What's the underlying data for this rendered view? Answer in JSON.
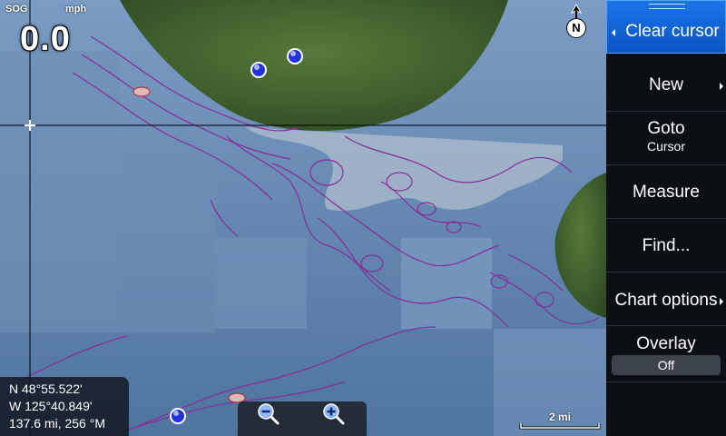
{
  "sog": {
    "label": "SOG",
    "unit": "mph",
    "value": "0.0"
  },
  "north": {
    "label": "N"
  },
  "position": {
    "lat": "N  48°55.522'",
    "lon": "W 125°40.849'",
    "range": "137.6 mi, 256 °M"
  },
  "scale": {
    "label": "2 mi"
  },
  "zoom": {
    "out_icon": "zoom-out-icon",
    "in_icon": "zoom-in-icon"
  },
  "menu": {
    "clear_cursor": "Clear cursor",
    "new": "New",
    "goto": "Goto",
    "goto_sub": "Cursor",
    "measure": "Measure",
    "find": "Find...",
    "chart_options": "Chart options",
    "overlay": "Overlay",
    "overlay_value": "Off"
  },
  "colors": {
    "water": "#5a7ea6",
    "land": "#3e5a2e",
    "contour": "#8a2a9a",
    "menu_active": "#1b74e8",
    "menu_bg": "#0c0f14"
  }
}
